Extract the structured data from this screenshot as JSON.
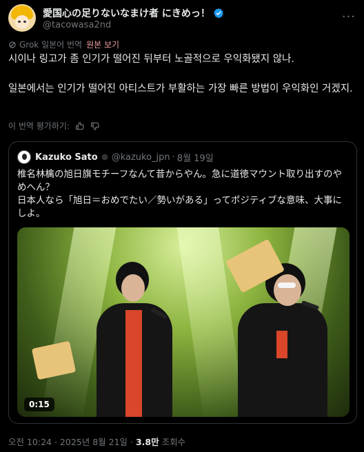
{
  "post": {
    "display_name": "愛国心の足りないなまけ者 にきめっ！",
    "handle": "@tacowasa2nd",
    "more": "···"
  },
  "translation": {
    "label": "Grok 일본어 번역",
    "original_link": "원본 보기"
  },
  "body": {
    "para1": "시이나 링고가 좀 인기가 떨어진 뒤부터 노골적으로 우익화됐지 않나.",
    "para2": "일본에서는 인기가 떨어진 아티스트가 부활하는 가장 빠른 방법이 우익화인 거겠지."
  },
  "rating": {
    "label": "이 번역 평가하기:"
  },
  "quote": {
    "name": "Kazuko Sato",
    "handle": "@kazuko_jpn",
    "separator": "·",
    "date": "8월 19일",
    "line1": "椎名林檎の旭日旗モチーフなんて昔からやん。急に道徳マウント取り出すのやめへん？",
    "line2": "日本人なら「旭日＝おめでたい／勢いがある」ってポジティブな意味、大事にしよ。",
    "video_time": "0:15"
  },
  "footer": {
    "time": "오전 10:24 · 2025년 8월 21일 · ",
    "views": "3.8만",
    "views_label": " 조회수"
  },
  "colors": {
    "background": "#000000",
    "verified": "#1d9bf0",
    "original_link": "#f0a0a0",
    "muted": "#71767b"
  }
}
